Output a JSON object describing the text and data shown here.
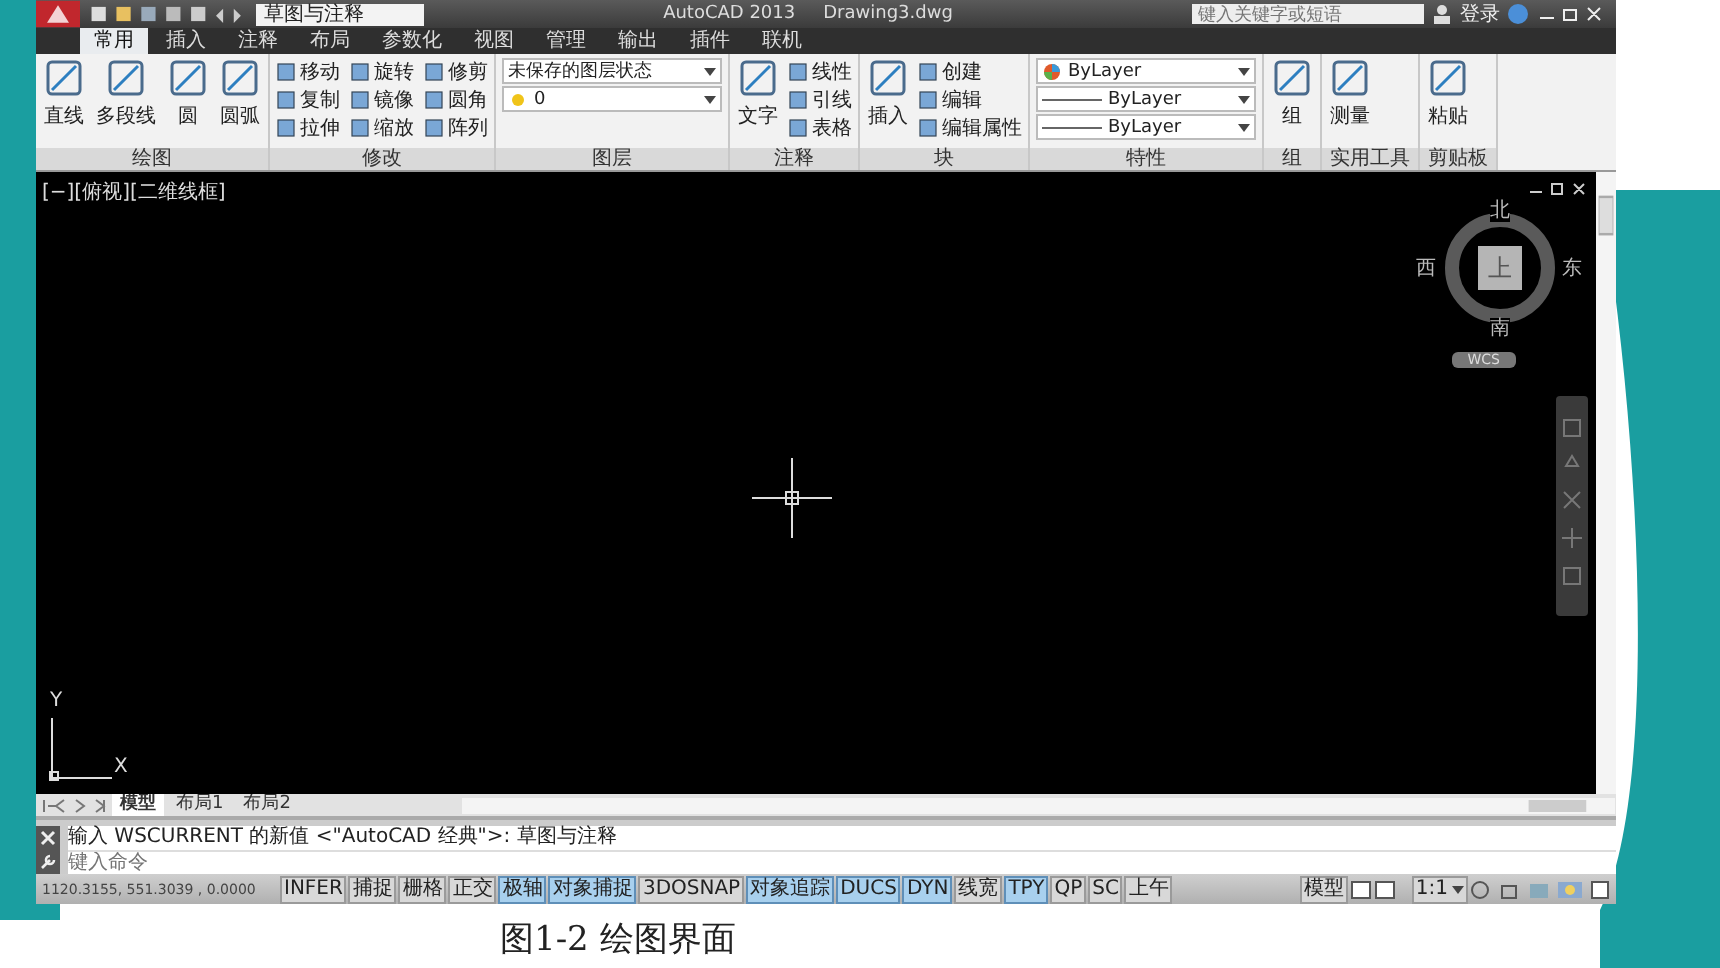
{
  "title_bar": {
    "workspace": "草图与注释",
    "app_title": "AutoCAD 2013",
    "file_name": "Drawing3.dwg",
    "search": {
      "placeholder": "键入关键字或短语"
    },
    "sign_in": "登录"
  },
  "ribbon_tabs": [
    {
      "label": "常用",
      "selected": true
    },
    {
      "label": "插入",
      "selected": false
    },
    {
      "label": "注释",
      "selected": false
    },
    {
      "label": "布局",
      "selected": false
    },
    {
      "label": "参数化",
      "selected": false
    },
    {
      "label": "视图",
      "selected": false
    },
    {
      "label": "管理",
      "selected": false
    },
    {
      "label": "输出",
      "selected": false
    },
    {
      "label": "插件",
      "selected": false
    },
    {
      "label": "联机",
      "selected": false
    }
  ],
  "panels": [
    {
      "title": "绘图",
      "large": [
        "直线",
        "多段线",
        "圆",
        "圆弧"
      ]
    },
    {
      "title": "修改",
      "small": [
        [
          "移动",
          "旋转",
          "修剪"
        ],
        [
          "复制",
          "镜像",
          "圆角"
        ],
        [
          "拉伸",
          "缩放",
          "阵列"
        ]
      ]
    },
    {
      "title": "图层",
      "dropdowns": [
        {
          "value": "未保存的图层状态",
          "kind": "plain"
        },
        {
          "value": "0",
          "kind": "layer"
        }
      ]
    },
    {
      "title": "注释",
      "large": [
        "文字"
      ],
      "small": [
        [
          "线性"
        ],
        [
          "引线"
        ],
        [
          "表格"
        ]
      ]
    },
    {
      "title": "块",
      "large": [
        "插入"
      ],
      "small": [
        [
          "创建"
        ],
        [
          "编辑"
        ],
        [
          "编辑属性"
        ]
      ]
    },
    {
      "title": "特性",
      "dropdowns": [
        {
          "value": "ByLayer",
          "kind": "color"
        },
        {
          "value": "ByLayer",
          "kind": "line"
        },
        {
          "value": "ByLayer",
          "kind": "line"
        }
      ]
    },
    {
      "title": "组",
      "large": [
        "组"
      ]
    },
    {
      "title": "实用工具",
      "large": [
        "测量"
      ]
    },
    {
      "title": "剪贴板",
      "large": [
        "粘贴"
      ]
    }
  ],
  "viewport_label": "[−][俯视][二维线框]",
  "view_cube": {
    "north": "北",
    "south": "南",
    "east": "东",
    "west": "西",
    "face": "上",
    "ucs": "WCS"
  },
  "ucs_axes": {
    "y": "Y",
    "x": "X"
  },
  "layout_tabs": [
    {
      "label": "模型",
      "selected": true
    },
    {
      "label": "布局1",
      "selected": false
    },
    {
      "label": "布局2",
      "selected": false
    }
  ],
  "command": {
    "history": "输入 WSCURRENT 的新值 <\"AutoCAD 经典\">: 草图与注释",
    "placeholder": "键入命令"
  },
  "status_bar": {
    "coordinates": "1120.3155, 551.3039 , 0.0000",
    "toggles": [
      {
        "label": "INFER",
        "on": false
      },
      {
        "label": "捕捉",
        "on": false
      },
      {
        "label": "栅格",
        "on": false
      },
      {
        "label": "正交",
        "on": false
      },
      {
        "label": "极轴",
        "on": true
      },
      {
        "label": "对象捕捉",
        "on": true
      },
      {
        "label": "3DOSNAP",
        "on": false
      },
      {
        "label": "对象追踪",
        "on": true
      },
      {
        "label": "DUCS",
        "on": true
      },
      {
        "label": "DYN",
        "on": true
      },
      {
        "label": "线宽",
        "on": false
      },
      {
        "label": "TPY",
        "on": true
      },
      {
        "label": "QP",
        "on": false
      },
      {
        "label": "SC",
        "on": false
      },
      {
        "label": "上午",
        "on": false
      }
    ],
    "model": "模型",
    "scale": "1:1"
  },
  "caption": "图1-2  绘图界面"
}
